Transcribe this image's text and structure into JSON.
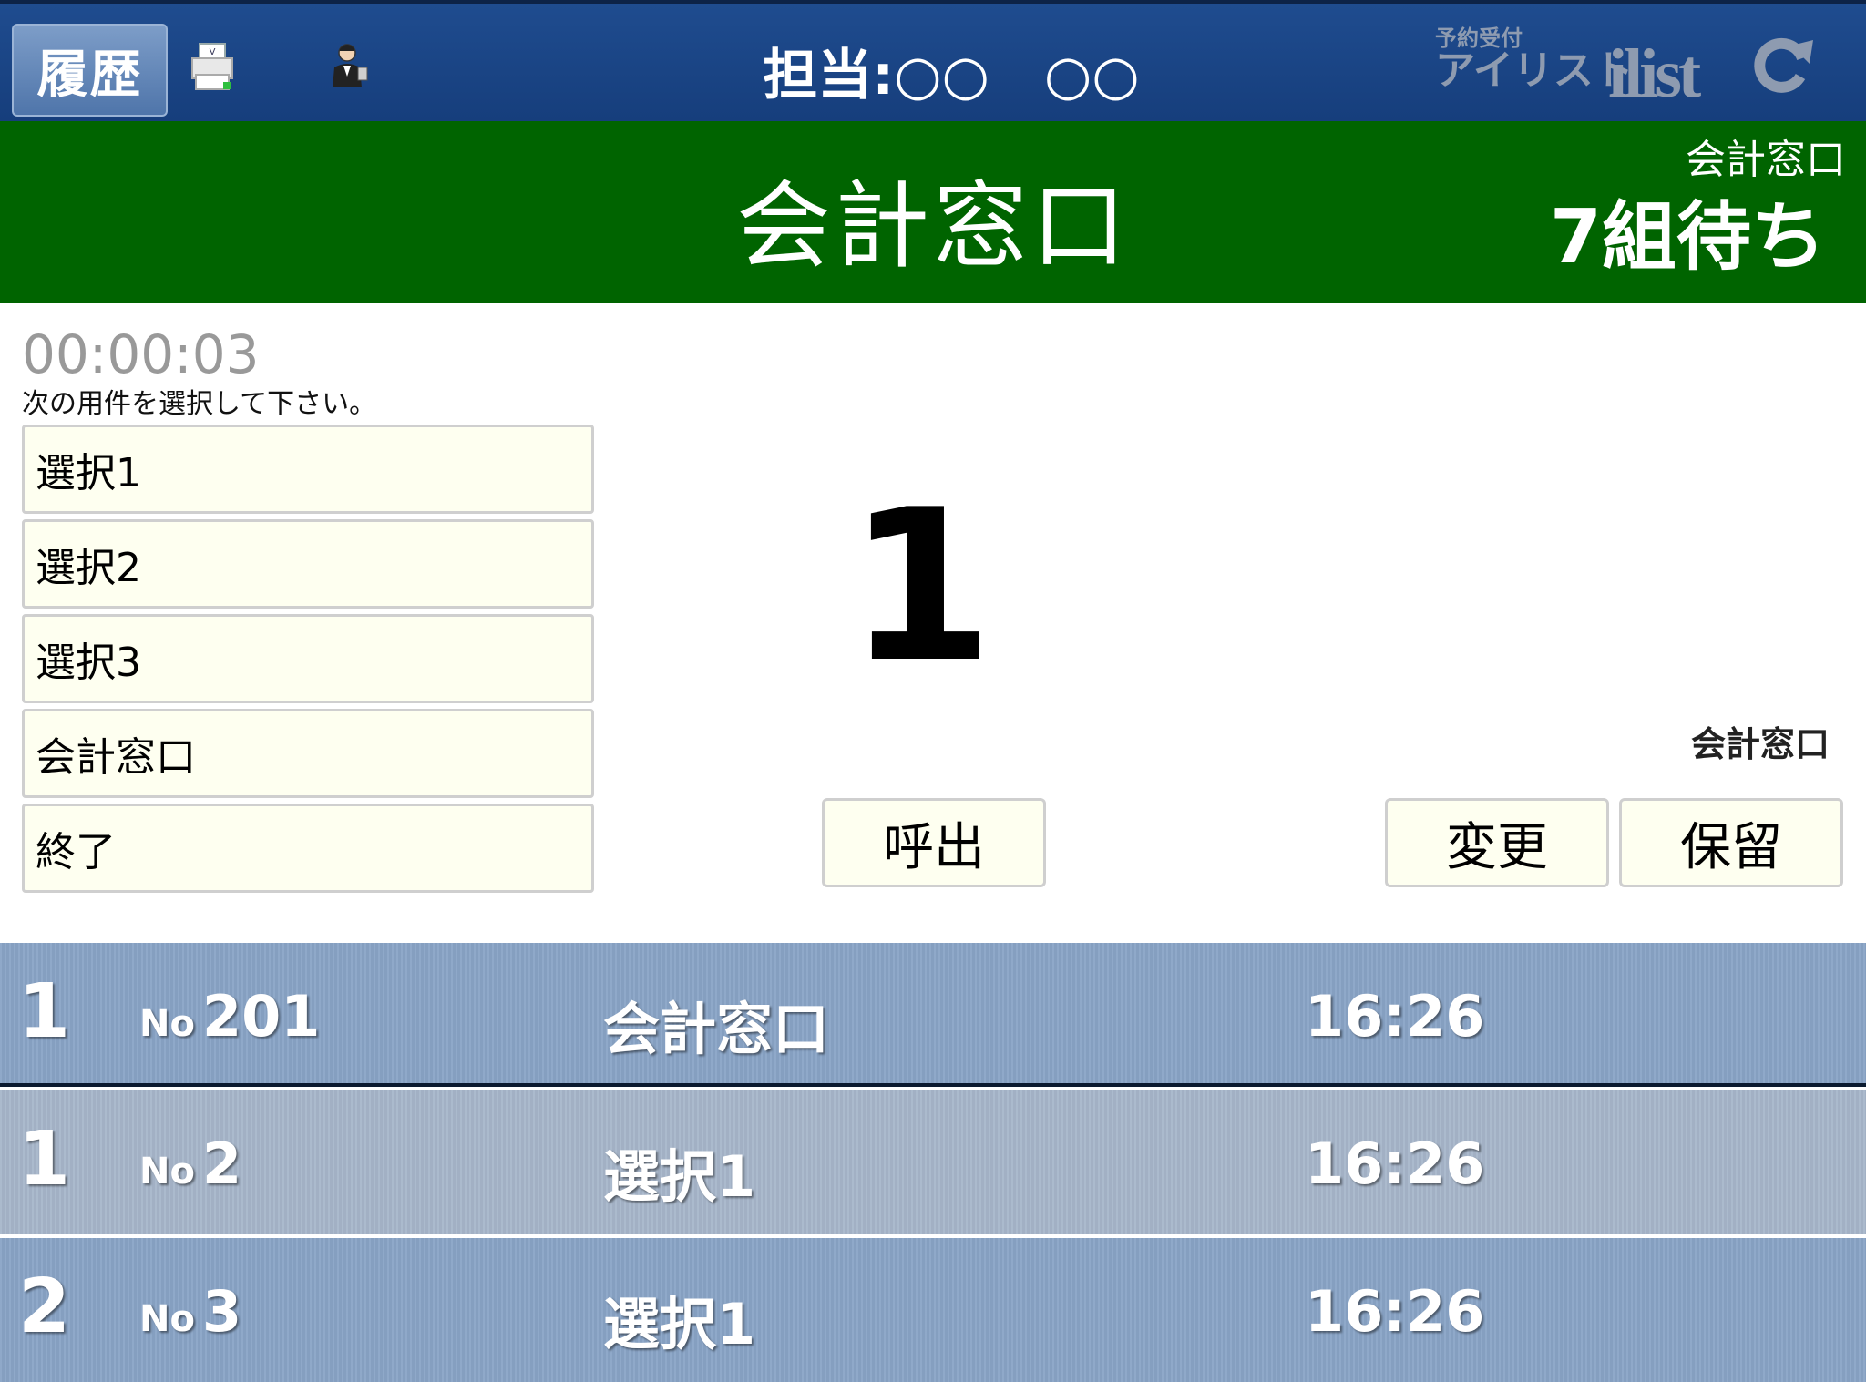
{
  "header": {
    "history_label": "履歴",
    "staff_label": "担当:○○　○○",
    "brand_small": "予約受付",
    "brand_large": "アイリスト",
    "brand_logo": "ilist"
  },
  "banner": {
    "title": "会計窓口",
    "counter_name": "会計窓口",
    "wait_text": "7組待ち",
    "color": "#006400"
  },
  "panel": {
    "timer": "00:00:03",
    "instruction": "次の用件を選択して下さい。",
    "choices": [
      "選択1",
      "選択2",
      "選択3",
      "会計窓口",
      "終了"
    ],
    "current_number": "1",
    "counter_label": "会計窓口",
    "call_label": "呼出",
    "change_label": "変更",
    "hold_label": "保留"
  },
  "queue": [
    {
      "position": "1",
      "no_label": "No",
      "number": "201",
      "service": "会計窓口",
      "time": "16:26"
    },
    {
      "position": "1",
      "no_label": "No",
      "number": "2",
      "service": "選択1",
      "time": "16:26"
    },
    {
      "position": "2",
      "no_label": "No",
      "number": "3",
      "service": "選択1",
      "time": "16:26"
    }
  ]
}
